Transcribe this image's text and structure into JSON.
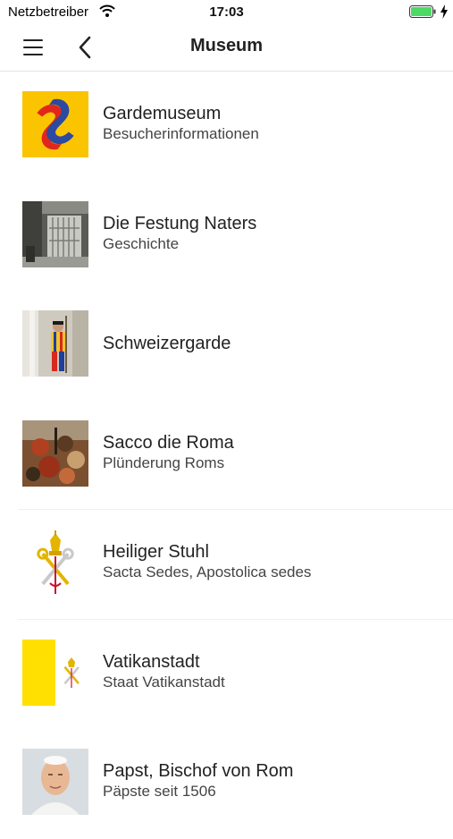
{
  "status_bar": {
    "carrier": "Netzbetreiber",
    "time": "17:03",
    "icons": [
      "wifi-icon",
      "battery-icon",
      "charging-bolt-icon"
    ],
    "battery_color": "#4cd964"
  },
  "nav": {
    "title": "Museum",
    "icons": [
      "hamburger-menu-icon",
      "chevron-left-icon"
    ]
  },
  "list": {
    "items": [
      {
        "title": "Gardemuseum",
        "subtitle": "Besucherinformationen",
        "thumb": "gardemuseum-logo"
      },
      {
        "title": "Die Festung Naters",
        "subtitle": "Geschichte",
        "thumb": "fortress-door-photo"
      },
      {
        "title": "Schweizergarde",
        "subtitle": "",
        "thumb": "swiss-guard-photo"
      },
      {
        "title": "Sacco die Roma",
        "subtitle": "Plünderung Roms",
        "thumb": "battle-painting"
      },
      {
        "title": "Heiliger Stuhl",
        "subtitle": "Sacta Sedes, Apostolica sedes",
        "thumb": "holy-see-emblem"
      },
      {
        "title": "Vatikanstadt",
        "subtitle": "Staat Vatikanstadt",
        "thumb": "vatican-flag"
      },
      {
        "title": "Papst, Bischof von Rom",
        "subtitle": "Päpste seit 1506",
        "thumb": "pope-portrait"
      }
    ]
  },
  "colors": {
    "logo_yellow": "#fbc400",
    "flag_yellow": "#ffe000",
    "separator": "#f0f0f0"
  }
}
